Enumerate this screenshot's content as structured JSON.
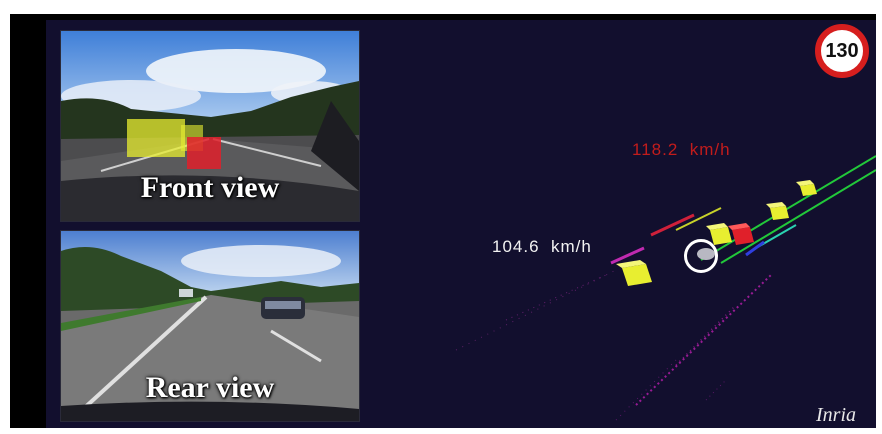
{
  "panels": {
    "front_label": "Front view",
    "rear_label": "Rear view"
  },
  "readouts": {
    "ego_speed": "104.6  km/h",
    "lead_speed": "118.2  km/h"
  },
  "speed_limit": "130",
  "brand": "Inria",
  "colors": {
    "background": "#120f2e",
    "lead_speed_text": "#c21c1c",
    "ego_speed_text": "#f2f2f2",
    "lane_line": "#22c83a",
    "tracked_vehicle": "#e8ee30",
    "lead_vehicle": "#e0202a",
    "speed_sign_ring": "#d61e1e"
  },
  "icons": {
    "speed_limit_sign": "speed-limit-sign-icon",
    "ego_vehicle_marker": "ego-vehicle-marker-icon"
  }
}
